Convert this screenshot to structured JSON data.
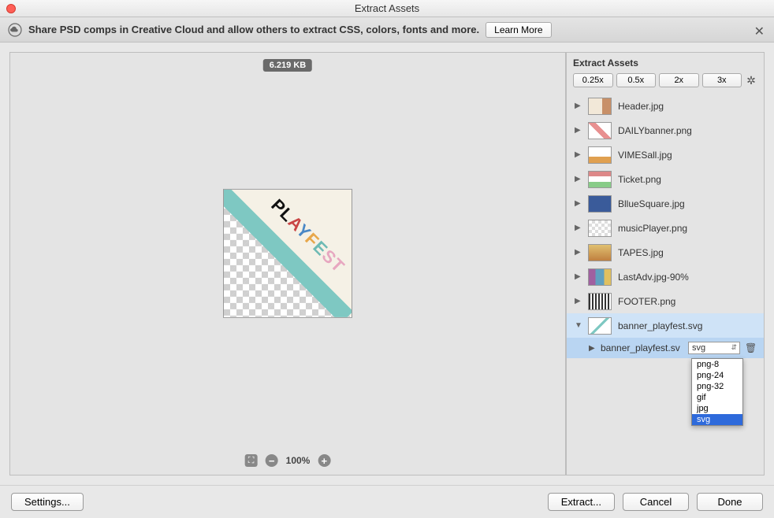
{
  "window": {
    "title": "Extract Assets"
  },
  "banner": {
    "message": "Share PSD comps in Creative Cloud and allow others to extract CSS, colors, fonts and more.",
    "learn_more": "Learn More"
  },
  "preview": {
    "file_size": "6.219 KB",
    "zoom_level": "100%",
    "artwork_text": "PLAYFEST"
  },
  "sidebar": {
    "title": "Extract Assets",
    "scales": [
      "0.25x",
      "0.5x",
      "2x",
      "3x"
    ],
    "assets": [
      {
        "name": "Header.jpg",
        "thumb": "header"
      },
      {
        "name": "DAILYbanner.png",
        "thumb": "stripe"
      },
      {
        "name": "VIMESall.jpg",
        "thumb": "vimes"
      },
      {
        "name": "Ticket.png",
        "thumb": "ticket"
      },
      {
        "name": "BllueSquare.jpg",
        "thumb": "blue"
      },
      {
        "name": "musicPlayer.png",
        "thumb": "checker"
      },
      {
        "name": "TAPES.jpg",
        "thumb": "tapes"
      },
      {
        "name": "LastAdv.jpg-90%",
        "thumb": "last"
      },
      {
        "name": "FOOTER.png",
        "thumb": "footer"
      },
      {
        "name": "banner_playfest.svg",
        "thumb": "svg",
        "expanded": true
      }
    ],
    "sub_asset": {
      "name": "banner_playfest.sv",
      "format": "svg"
    },
    "format_options": [
      "png-8",
      "png-24",
      "png-32",
      "gif",
      "jpg",
      "svg"
    ],
    "format_selected": "svg"
  },
  "footer": {
    "settings": "Settings...",
    "extract": "Extract...",
    "cancel": "Cancel",
    "done": "Done"
  }
}
